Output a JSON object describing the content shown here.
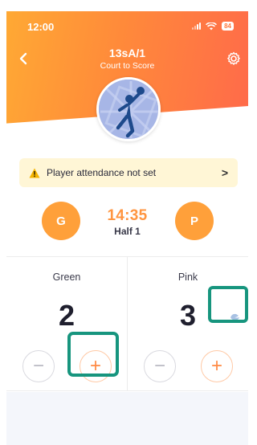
{
  "status_bar": {
    "time": "12:00",
    "battery": "84"
  },
  "header": {
    "title": "13sA/1",
    "subtitle": "Court to Score"
  },
  "banner": {
    "text": "Player attendance not set",
    "chevron": ">"
  },
  "timer": {
    "clock": "14:35",
    "half": "Half 1"
  },
  "teams": {
    "left": {
      "initial": "G",
      "name": "Green",
      "score": "2"
    },
    "right": {
      "initial": "P",
      "name": "Pink",
      "score": "3"
    }
  },
  "controls": {
    "minus": "−",
    "plus": "+"
  },
  "colors": {
    "header_start": "#ffa934",
    "header_end": "#ff6a4a",
    "accent": "#ff9540",
    "highlight": "#17957e",
    "banner_bg": "#fff6d6"
  },
  "icons": [
    "back-chevron-icon",
    "gear-icon",
    "warning-icon",
    "chevron-right-icon",
    "signal-icon",
    "wifi-icon",
    "battery-icon",
    "netball-player-icon"
  ]
}
